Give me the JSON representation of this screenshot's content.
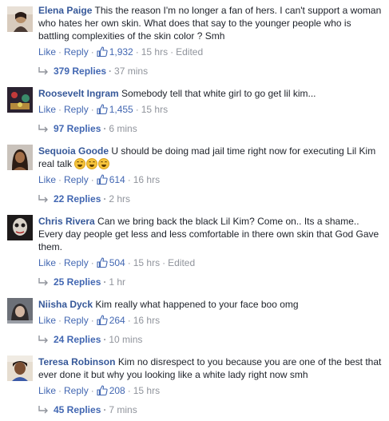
{
  "ui": {
    "like": "Like",
    "reply": "Reply",
    "separator": "·"
  },
  "comments": [
    {
      "author": "Elena Paige",
      "text": "This the reason I'm no longer a fan of hers. I can't support a woman who hates her own skin. What does that say to the younger people who is battling complexities of the skin color ? Smh",
      "likes": "1,932",
      "time": "15 hrs",
      "edited": "Edited",
      "replies": "379 Replies",
      "replies_time": "37 mins"
    },
    {
      "author": "Roosevelt Ingram",
      "text": "Somebody tell that white girl to go get lil kim...",
      "likes": "1,455",
      "time": "15 hrs",
      "replies": "97 Replies",
      "replies_time": "6 mins"
    },
    {
      "author": "Sequoia Goode",
      "text": "U should be doing mad jail time right now for executing Lil Kim real talk",
      "likes": "614",
      "time": "16 hrs",
      "replies": "22 Replies",
      "replies_time": "2 hrs"
    },
    {
      "author": "Chris Rivera",
      "text": "Can we bring back the black Lil Kim? Come on.. Its a shame.. Every day people get less and less comfortable in there own skin that God Gave them.",
      "likes": "504",
      "time": "15 hrs",
      "edited": "Edited",
      "replies": "25 Replies",
      "replies_time": "1 hr"
    },
    {
      "author": "Niisha Dyck",
      "text": "Kim really what happened to your face boo omg",
      "likes": "264",
      "time": "16 hrs",
      "replies": "24 Replies",
      "replies_time": "10 mins"
    },
    {
      "author": "Teresa Robinson",
      "text": "Kim no disrespect to you because you are one of the best that ever done it but why you looking like a white lady right now smh",
      "likes": "208",
      "time": "15 hrs",
      "replies": "45 Replies",
      "replies_time": "7 mins"
    }
  ],
  "icons": {
    "like_count": "thumbs-up-icon",
    "replies_arrow": "reply-arrow-icon",
    "emoji": "grinning-face-icon"
  },
  "colors": {
    "link": "#4267b2",
    "author": "#365899",
    "meta": "#90949c",
    "text": "#1d2129"
  }
}
